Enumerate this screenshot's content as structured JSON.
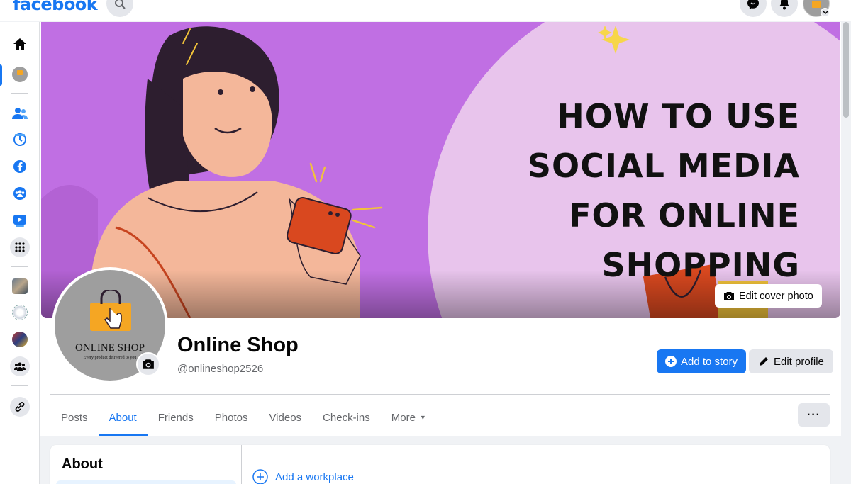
{
  "header": {
    "logo": "facebook",
    "icons": [
      "search-icon",
      "messenger-icon",
      "bell-icon",
      "account-avatar"
    ]
  },
  "rail": {
    "items": [
      "home-icon",
      "page-avatar",
      "friends-icon",
      "memories-icon",
      "facebook-icon",
      "groups-icon",
      "watch-icon",
      "apps-grid-icon",
      "shortcut-photo-1",
      "shortcut-photo-2",
      "shortcut-photo-3",
      "people-icon",
      "link-icon"
    ]
  },
  "cover": {
    "headline": "HOW TO USE SOCIAL MEDIA FOR ONLINE SHOPPING",
    "edit_label": "Edit cover photo"
  },
  "profile": {
    "avatar_name": "ONLINE SHOP",
    "avatar_tagline": "Every product delivered to you",
    "name": "Online Shop",
    "handle": "@onlineshop2526",
    "add_story_label": "Add to story",
    "edit_profile_label": "Edit profile"
  },
  "tabs": {
    "items": [
      "Posts",
      "About",
      "Friends",
      "Photos",
      "Videos",
      "Check-ins",
      "More"
    ],
    "active": "About",
    "more_options": "···"
  },
  "about": {
    "title": "About",
    "add_workplace": "Add a workplace"
  },
  "colors": {
    "brand": "#1877f2",
    "cover_purple": "#c06fe3",
    "cover_circle": "#e8c4ec",
    "avatar_gray": "#9e9e9e"
  }
}
